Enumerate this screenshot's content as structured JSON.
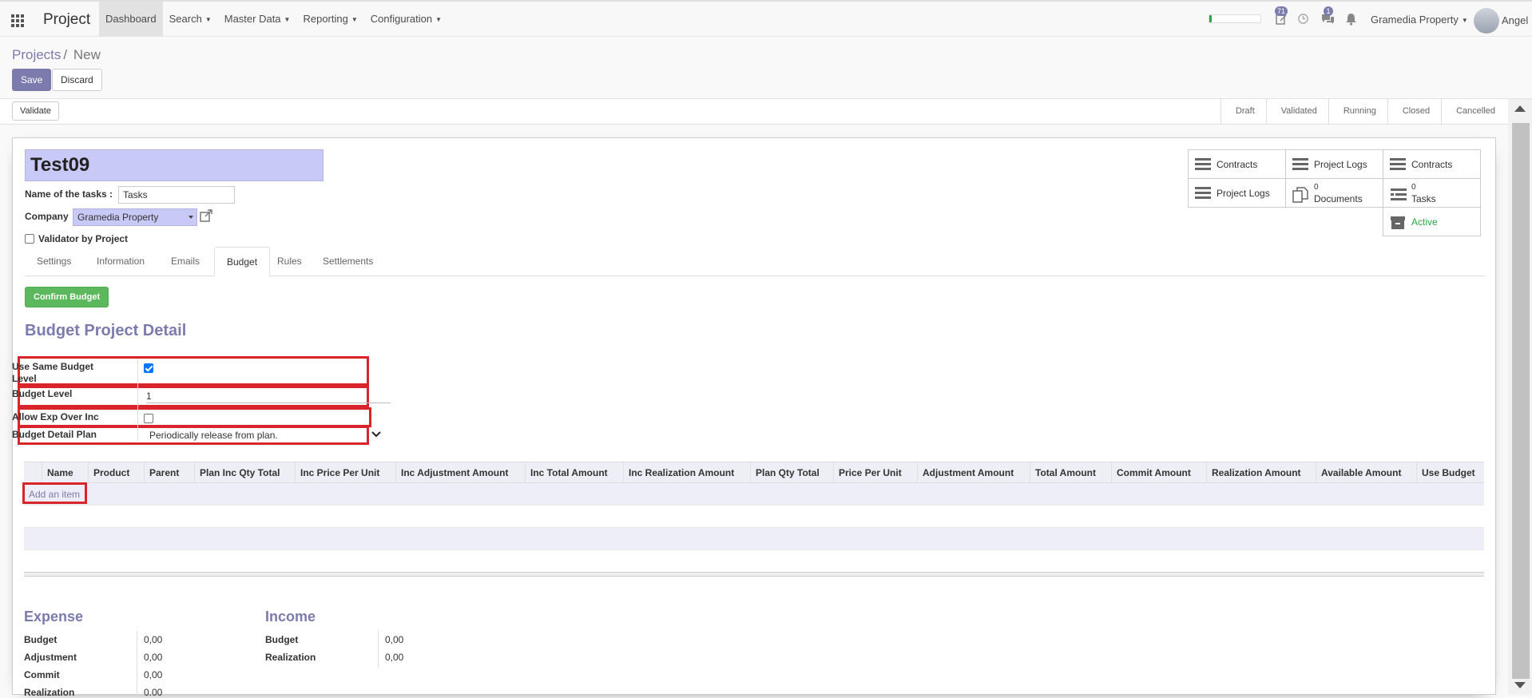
{
  "navbar": {
    "app_title": "Project",
    "menu": [
      {
        "label": "Dashboard",
        "has_caret": false
      },
      {
        "label": "Search",
        "has_caret": true
      },
      {
        "label": "Master Data",
        "has_caret": true
      },
      {
        "label": "Reporting",
        "has_caret": true
      },
      {
        "label": "Configuration",
        "has_caret": true
      }
    ],
    "progress_fraction": 0.05,
    "activity_badge": "71",
    "chat_badge": "1",
    "company": "Gramedia Property",
    "user": "Angel"
  },
  "breadcrumb": {
    "parent": "Projects",
    "separator": "/",
    "current": "New"
  },
  "buttons": {
    "save": "Save",
    "discard": "Discard",
    "validate": "Validate",
    "confirm_budget": "Confirm Budget"
  },
  "stages": [
    "Draft",
    "Validated",
    "Running",
    "Closed",
    "Cancelled"
  ],
  "form": {
    "name": "Test09",
    "tasks_label": "Name of the tasks :",
    "tasks_value": "Tasks",
    "company_label": "Company",
    "company_value": "Gramedia Property",
    "validator_label": "Validator by Project",
    "validator_checked": false
  },
  "smart_buttons": [
    {
      "label": "Contracts",
      "icon": "list-icon"
    },
    {
      "label": "Project Logs",
      "icon": "list-icon"
    },
    {
      "label": "Contracts",
      "icon": "list-icon"
    },
    {
      "label": "Project Logs",
      "icon": "list-icon"
    },
    {
      "count": "0",
      "label": "Documents",
      "icon": "documents-icon"
    },
    {
      "count": "0",
      "label": "Tasks",
      "icon": "tasks-icon"
    },
    {
      "label": "Active",
      "icon": "archive-icon"
    }
  ],
  "tabs": [
    "Settings",
    "Information",
    "Emails",
    "Budget",
    "Rules",
    "Settlements"
  ],
  "active_tab": "Budget",
  "budget": {
    "section_title": "Budget Project Detail",
    "use_same_label": "Use Same Budget Level",
    "use_same_checked": true,
    "level_label": "Budget Level",
    "level_value": "1",
    "allow_label": "Allow Exp Over Inc",
    "allow_checked": false,
    "plan_label": "Budget Detail Plan",
    "plan_value": "Periodically release from plan."
  },
  "table": {
    "columns": [
      "Name",
      "Product",
      "Parent",
      "Plan Inc Qty Total",
      "Inc Price Per Unit",
      "Inc Adjustment Amount",
      "Inc Total Amount",
      "Inc Realization Amount",
      "Plan Qty Total",
      "Price Per Unit",
      "Adjustment Amount",
      "Total Amount",
      "Commit Amount",
      "Realization Amount",
      "Available Amount",
      "Use Budget"
    ],
    "add_item": "Add an item"
  },
  "expense": {
    "title": "Expense",
    "rows": [
      {
        "label": "Budget",
        "value": "0,00"
      },
      {
        "label": "Adjustment",
        "value": "0,00"
      },
      {
        "label": "Commit",
        "value": "0,00"
      },
      {
        "label": "Realization",
        "value": "0.00"
      }
    ]
  },
  "income": {
    "title": "Income",
    "rows": [
      {
        "label": "Budget",
        "value": "0,00"
      },
      {
        "label": "Realization",
        "value": "0,00"
      }
    ]
  },
  "colors": {
    "accent": "#7c7bad",
    "success": "#5cb85c",
    "highlight": "#d9242b",
    "required_field": "#c9c9f7"
  }
}
